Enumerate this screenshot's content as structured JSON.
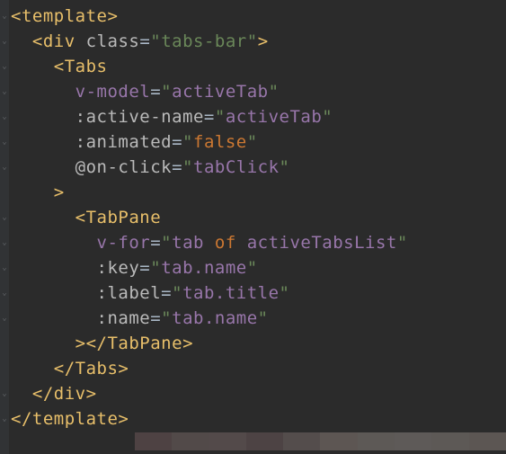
{
  "theme": {
    "background": "#2b2b2b",
    "gutter": "#313335",
    "tag": "#e8bf6a",
    "attr": "#bababa",
    "string": "#6a8759",
    "identifier": "#9876aa",
    "keyword": "#cc7832",
    "default": "#a9b7c6"
  },
  "code": {
    "lines": [
      {
        "indent": 0,
        "tokens": [
          {
            "t": "<",
            "c": "punct"
          },
          {
            "t": "template",
            "c": "tag"
          },
          {
            "t": ">",
            "c": "punct"
          }
        ]
      },
      {
        "indent": 1,
        "tokens": [
          {
            "t": "<",
            "c": "punct"
          },
          {
            "t": "div",
            "c": "tag"
          },
          {
            "t": " ",
            "c": "op"
          },
          {
            "t": "class",
            "c": "attr"
          },
          {
            "t": "=",
            "c": "op"
          },
          {
            "t": "\"",
            "c": "quote"
          },
          {
            "t": "tabs-bar",
            "c": "str"
          },
          {
            "t": "\"",
            "c": "quote"
          },
          {
            "t": ">",
            "c": "punct"
          }
        ]
      },
      {
        "indent": 2,
        "tokens": [
          {
            "t": "<",
            "c": "punct"
          },
          {
            "t": "Tabs",
            "c": "tag"
          }
        ]
      },
      {
        "indent": 3,
        "tokens": [
          {
            "t": "v-model",
            "c": "dir"
          },
          {
            "t": "=",
            "c": "op"
          },
          {
            "t": "\"",
            "c": "quote"
          },
          {
            "t": "activeTab",
            "c": "ident"
          },
          {
            "t": "\"",
            "c": "quote"
          }
        ]
      },
      {
        "indent": 3,
        "tokens": [
          {
            "t": ":active-name",
            "c": "attr"
          },
          {
            "t": "=",
            "c": "op"
          },
          {
            "t": "\"",
            "c": "quote"
          },
          {
            "t": "activeTab",
            "c": "ident"
          },
          {
            "t": "\"",
            "c": "quote"
          }
        ]
      },
      {
        "indent": 3,
        "tokens": [
          {
            "t": ":animated",
            "c": "attr"
          },
          {
            "t": "=",
            "c": "op"
          },
          {
            "t": "\"",
            "c": "quote"
          },
          {
            "t": "false",
            "c": "key"
          },
          {
            "t": "\"",
            "c": "quote"
          }
        ]
      },
      {
        "indent": 3,
        "tokens": [
          {
            "t": "@on-click",
            "c": "attr"
          },
          {
            "t": "=",
            "c": "op"
          },
          {
            "t": "\"",
            "c": "quote"
          },
          {
            "t": "tabClick",
            "c": "ident"
          },
          {
            "t": "\"",
            "c": "quote"
          }
        ]
      },
      {
        "indent": 2,
        "tokens": [
          {
            "t": ">",
            "c": "punct"
          }
        ]
      },
      {
        "indent": 3,
        "tokens": [
          {
            "t": "<",
            "c": "punct"
          },
          {
            "t": "TabPane",
            "c": "tag"
          }
        ]
      },
      {
        "indent": 4,
        "tokens": [
          {
            "t": "v-for",
            "c": "dir"
          },
          {
            "t": "=",
            "c": "op"
          },
          {
            "t": "\"",
            "c": "quote"
          },
          {
            "t": "tab ",
            "c": "ident"
          },
          {
            "t": "of",
            "c": "key"
          },
          {
            "t": " activeTabsList",
            "c": "ident"
          },
          {
            "t": "\"",
            "c": "quote"
          }
        ]
      },
      {
        "indent": 4,
        "tokens": [
          {
            "t": ":key",
            "c": "attr"
          },
          {
            "t": "=",
            "c": "op"
          },
          {
            "t": "\"",
            "c": "quote"
          },
          {
            "t": "tab.name",
            "c": "ident"
          },
          {
            "t": "\"",
            "c": "quote"
          }
        ]
      },
      {
        "indent": 4,
        "tokens": [
          {
            "t": ":label",
            "c": "attr"
          },
          {
            "t": "=",
            "c": "op"
          },
          {
            "t": "\"",
            "c": "quote"
          },
          {
            "t": "tab.title",
            "c": "ident"
          },
          {
            "t": "\"",
            "c": "quote"
          }
        ]
      },
      {
        "indent": 4,
        "tokens": [
          {
            "t": ":name",
            "c": "attr"
          },
          {
            "t": "=",
            "c": "op"
          },
          {
            "t": "\"",
            "c": "quote"
          },
          {
            "t": "tab.name",
            "c": "ident"
          },
          {
            "t": "\"",
            "c": "quote"
          }
        ]
      },
      {
        "indent": 3,
        "tokens": [
          {
            "t": ">",
            "c": "punct"
          },
          {
            "t": "</",
            "c": "punct"
          },
          {
            "t": "TabPane",
            "c": "tag"
          },
          {
            "t": ">",
            "c": "punct"
          }
        ]
      },
      {
        "indent": 2,
        "tokens": [
          {
            "t": "</",
            "c": "punct"
          },
          {
            "t": "Tabs",
            "c": "tag"
          },
          {
            "t": ">",
            "c": "punct"
          }
        ]
      },
      {
        "indent": 1,
        "tokens": [
          {
            "t": "</",
            "c": "punct"
          },
          {
            "t": "div",
            "c": "tag"
          },
          {
            "t": ">",
            "c": "punct"
          }
        ]
      },
      {
        "indent": 0,
        "tokens": [
          {
            "t": "</",
            "c": "punct"
          },
          {
            "t": "template",
            "c": "tag"
          },
          {
            "t": ">",
            "c": "punct"
          }
        ]
      }
    ],
    "fold_markers": [
      0,
      1,
      2,
      3,
      4,
      5,
      6,
      8,
      9,
      10,
      11,
      12,
      15,
      16
    ],
    "indent_unit": "  "
  },
  "glitch_colors": [
    "#b7888a",
    "#c9a7a3",
    "#caa9a7",
    "#b38d8f",
    "#d0b4af",
    "#f2d6cc",
    "#f5e3d8",
    "#f6e9e0",
    "#f3e2d8",
    "#efd9cc"
  ]
}
